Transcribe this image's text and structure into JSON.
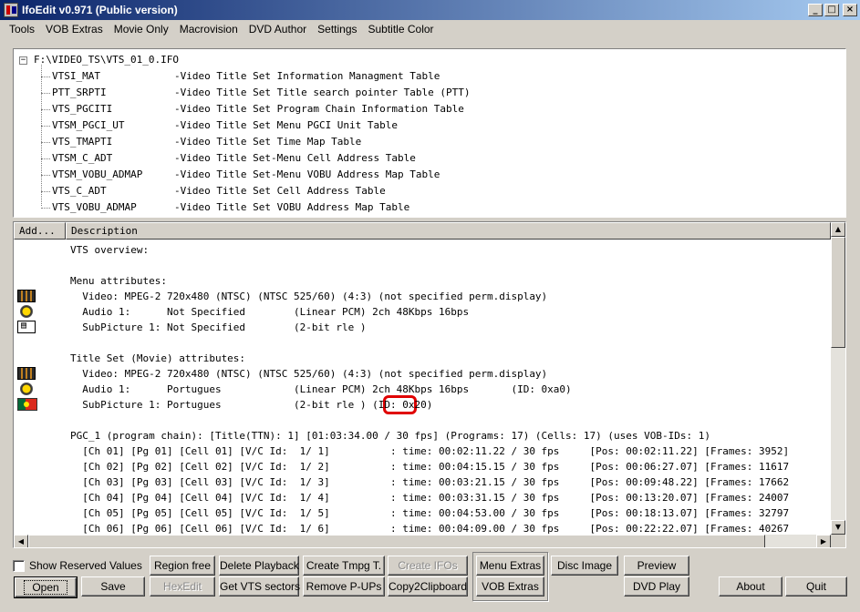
{
  "window": {
    "title": "IfoEdit v0.971 (Public version)",
    "controls": [
      "_",
      "□",
      "×"
    ]
  },
  "menu": [
    "Tools",
    "VOB Extras",
    "Movie Only",
    "Macrovision",
    "DVD Author",
    "Settings",
    "Subtitle Color"
  ],
  "tree": {
    "root": "F:\\VIDEO_TS\\VTS_01_0.IFO",
    "toggle": "−",
    "items": [
      {
        "name": "VTSI_MAT",
        "desc": "-Video Title Set Information Managment Table"
      },
      {
        "name": "PTT_SRPTI",
        "desc": "-Video Title Set Title search pointer Table (PTT)"
      },
      {
        "name": "VTS_PGCITI",
        "desc": "-Video Title Set Program Chain Information Table"
      },
      {
        "name": "VTSM_PGCI_UT",
        "desc": "-Video Title Set Menu PGCI Unit Table"
      },
      {
        "name": "VTS_TMAPTI",
        "desc": "-Video Title Set Time Map Table"
      },
      {
        "name": "VTSM_C_ADT",
        "desc": "-Video Title Set-Menu Cell Address Table"
      },
      {
        "name": "VTSM_VOBU_ADMAP",
        "desc": "-Video Title Set-Menu VOBU Address Map Table"
      },
      {
        "name": "VTS_C_ADT",
        "desc": "-Video Title Set Cell Address Table"
      },
      {
        "name": "VTS_VOBU_ADMAP",
        "desc": "-Video Title Set VOBU Address Map Table"
      }
    ]
  },
  "list": {
    "headers": [
      "Add...",
      "Description"
    ],
    "lines": [
      {
        "text": "VTS overview:",
        "icon": ""
      },
      {
        "text": "",
        "icon": ""
      },
      {
        "text": "Menu attributes:",
        "icon": ""
      },
      {
        "text": "  Video: MPEG-2 720x480 (NTSC) (NTSC 525/60) (4:3) (not specified perm.display)",
        "icon": "film-icon"
      },
      {
        "text": "  Audio 1:      Not Specified        (Linear PCM) 2ch 48Kbps 16bps",
        "icon": "audio-icon"
      },
      {
        "text": "  SubPicture 1: Not Specified        (2-bit rle )",
        "icon": "subpicture-icon"
      },
      {
        "text": "",
        "icon": ""
      },
      {
        "text": "Title Set (Movie) attributes:",
        "icon": ""
      },
      {
        "text": "  Video: MPEG-2 720x480 (NTSC) (NTSC 525/60) (4:3) (not specified perm.display)",
        "icon": "film-icon"
      },
      {
        "text": "  Audio 1:      Portugues            (Linear PCM) 2ch 48Kbps 16bps       (ID: 0xa0)",
        "icon": "audio-icon"
      },
      {
        "text": "  SubPicture 1: Portugues            (2-bit rle ) (ID: 0x20)",
        "icon": "flag-icon"
      },
      {
        "text": "",
        "icon": ""
      },
      {
        "text": "PGC_1 (program chain): [Title(TTN): 1] [01:03:34.00 / 30 fps] (Programs: 17) (Cells: 17) (uses VOB-IDs: 1)",
        "icon": ""
      },
      {
        "text": "  [Ch 01] [Pg 01] [Cell 01] [V/C Id:  1/ 1]          : time: 00:02:11.22 / 30 fps     [Pos: 00:02:11.22] [Frames: 3952]",
        "icon": ""
      },
      {
        "text": "  [Ch 02] [Pg 02] [Cell 02] [V/C Id:  1/ 2]          : time: 00:04:15.15 / 30 fps     [Pos: 00:06:27.07] [Frames: 11617",
        "icon": ""
      },
      {
        "text": "  [Ch 03] [Pg 03] [Cell 03] [V/C Id:  1/ 3]          : time: 00:03:21.15 / 30 fps     [Pos: 00:09:48.22] [Frames: 17662",
        "icon": ""
      },
      {
        "text": "  [Ch 04] [Pg 04] [Cell 04] [V/C Id:  1/ 4]          : time: 00:03:31.15 / 30 fps     [Pos: 00:13:20.07] [Frames: 24007",
        "icon": ""
      },
      {
        "text": "  [Ch 05] [Pg 05] [Cell 05] [V/C Id:  1/ 5]          : time: 00:04:53.00 / 30 fps     [Pos: 00:18:13.07] [Frames: 32797",
        "icon": ""
      },
      {
        "text": "  [Ch 06] [Pg 06] [Cell 06] [V/C Id:  1/ 6]          : time: 00:04:09.00 / 30 fps     [Pos: 00:22:22.07] [Frames: 40267",
        "icon": ""
      }
    ]
  },
  "buttons": {
    "show_reserved": "Show Reserved Values",
    "open": "Open",
    "save": "Save",
    "region_free": "Region free",
    "hexedit": "HexEdit",
    "delete_playback": "Delete Playback",
    "get_vts_sectors": "Get VTS sectors",
    "create_tmpg": "Create Tmpg T.",
    "remove_pups": "Remove P-UPs",
    "create_ifos": "Create IFOs",
    "copy2clipboard": "Copy2Clipboard",
    "menu_extras": "Menu Extras",
    "vob_extras": "VOB Extras",
    "disc_image": "Disc Image",
    "preview": "Preview",
    "dvd_play": "DVD Play",
    "about": "About",
    "quit": "Quit"
  },
  "scroll_arrows": {
    "up": "▲",
    "down": "▼",
    "left": "◀",
    "right": "▶"
  }
}
